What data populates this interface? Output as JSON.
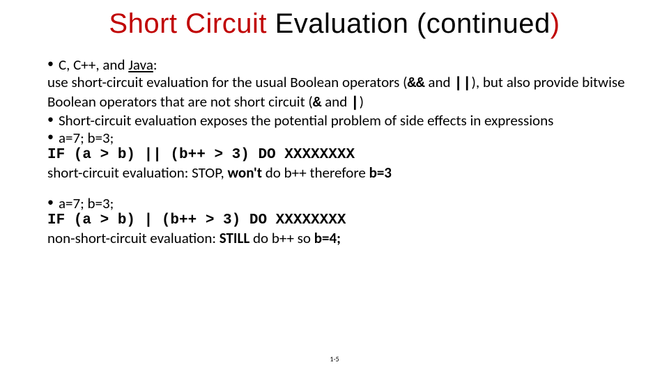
{
  "title": {
    "red1": "Short Circuit",
    "black": " Evaluation (continued",
    "red2": ")"
  },
  "p1": {
    "lead": "C, C++, and ",
    "u": "Java",
    "tail": ":"
  },
  "p2": {
    "a": "use short-circuit evaluation for the usual Boolean operators (",
    "op1": "&&",
    "b": " and ",
    "op2": "||",
    "c": "), but also provide bitwise Boolean operators that are not short circuit (",
    "op3": "&",
    "d": " and ",
    "op4": "|",
    "e": ")"
  },
  "p3": "Short-circuit evaluation exposes the potential problem of side effects in expressions",
  "p4": "a=7; b=3;",
  "code1": "IF (a > b) || (b++ > 3)  DO XXXXXXXX",
  "p5": {
    "a": "short-circuit evaluation: STOP, ",
    "b": "won't",
    "c": " do b++ therefore ",
    "d": "b=3"
  },
  "p6": "a=7; b=3;",
  "code2": "IF (a > b) | (b++ > 3)  DO XXXXXXXX",
  "p7": {
    "a": "non-short-circuit evaluation: ",
    "b": "STILL",
    "c": " do b++ so ",
    "d": "b=4;"
  },
  "page": "1-5"
}
